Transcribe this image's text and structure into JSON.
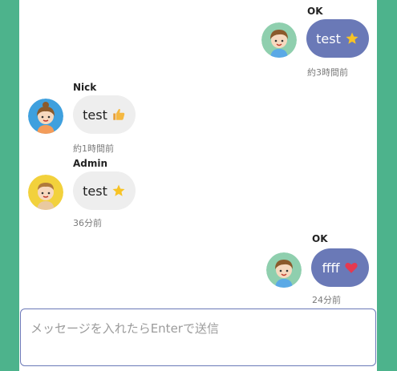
{
  "messages": [
    {
      "side": "mine",
      "name": "OK",
      "text": "test",
      "emoji": "star-emoji",
      "time": "約3時間前"
    },
    {
      "side": "theirs",
      "name": "Nick",
      "text": "test",
      "emoji": "thumbs-up-emoji",
      "time": "約1時間前"
    },
    {
      "side": "theirs",
      "name": "Admin",
      "text": "test",
      "emoji": "star-emoji",
      "time": "36分前"
    },
    {
      "side": "mine",
      "name": "OK",
      "text": "ffff",
      "emoji": "heart-emoji",
      "time": "24分前"
    }
  ],
  "composer": {
    "placeholder": "メッセージを入れたらEnterで送信"
  },
  "colors": {
    "background": "#4db38c",
    "my_bubble": "#6a79b7",
    "their_bubble": "#eeeeee"
  }
}
